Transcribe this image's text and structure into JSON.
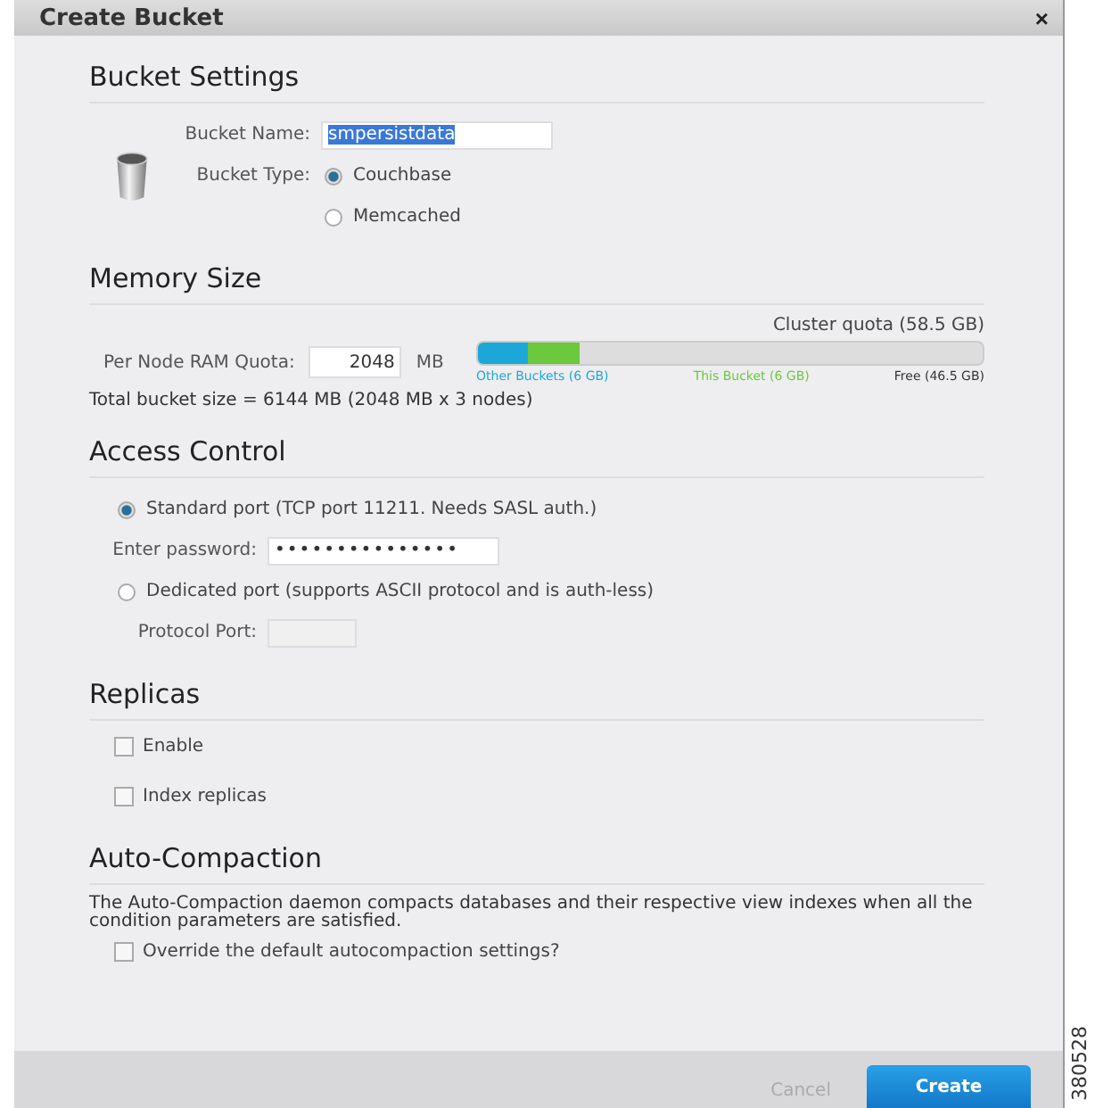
{
  "dialog": {
    "title": "Create Bucket",
    "close": "×"
  },
  "bucket_settings": {
    "heading": "Bucket Settings",
    "name_label": "Bucket Name:",
    "name_value": "smpersistdata",
    "type_label": "Bucket Type:",
    "types": [
      {
        "label": "Couchbase",
        "selected": true
      },
      {
        "label": "Memcached",
        "selected": false
      }
    ]
  },
  "memory": {
    "heading": "Memory Size",
    "quota_label": "Per Node RAM Quota:",
    "quota_value": "2048",
    "unit": "MB",
    "cluster_quota": "Cluster quota (58.5 GB)",
    "bar": [
      {
        "level": 0.1,
        "color": "#1ba8d8"
      },
      {
        "level": 0.1,
        "color": "#6cc83c"
      }
    ],
    "legend": [
      {
        "label": "Other Buckets (6 GB)",
        "color": "#1ba8d8"
      },
      {
        "label": "This Bucket (6 GB)",
        "color": "#6cc83c"
      },
      {
        "label": "Free (46.5 GB)",
        "color": "#333333"
      }
    ],
    "total": "Total bucket size = 6144 MB (2048 MB x 3 nodes)"
  },
  "access": {
    "heading": "Access Control",
    "options": [
      {
        "label": "Standard port (TCP port 11211. Needs SASL auth.)",
        "selected": true,
        "field_label": "Enter password:",
        "field_value": "•••••••••••••••"
      },
      {
        "label": "Dedicated port (supports ASCII protocol and is auth-less)",
        "selected": false,
        "field_label": "Protocol Port:"
      }
    ]
  },
  "replicas": {
    "heading": "Replicas",
    "checkboxes": [
      {
        "label": "Enable",
        "checked": false
      },
      {
        "label": "Index replicas",
        "checked": false
      }
    ]
  },
  "auto_compaction": {
    "heading": "Auto-Compaction",
    "description": "The Auto-Compaction daemon compacts databases and their respective view indexes when all the condition parameters are satisfied.",
    "checkboxes": [
      {
        "label": "Override the default autocompaction settings?",
        "checked": false
      }
    ]
  },
  "buttons": [
    {
      "label": "Cancel",
      "kind": "secondary"
    },
    {
      "label": "Create",
      "kind": "primary"
    }
  ],
  "figure_id": "380528"
}
